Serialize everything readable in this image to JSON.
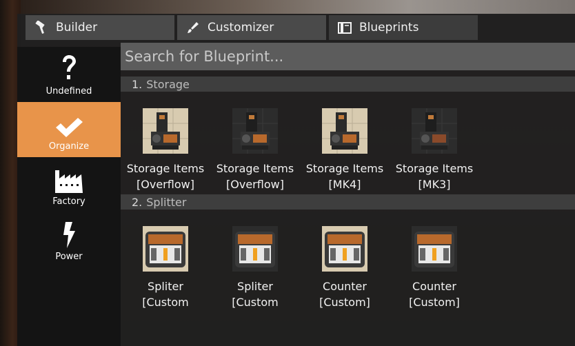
{
  "tabs": [
    {
      "label": "Builder",
      "icon": "hammer-icon",
      "active": false
    },
    {
      "label": "Customizer",
      "icon": "brush-icon",
      "active": false
    },
    {
      "label": "Blueprints",
      "icon": "blueprint-book-icon",
      "active": true
    }
  ],
  "sidebar": {
    "items": [
      {
        "label": "Undefined",
        "icon": "question-mark-icon",
        "active": false
      },
      {
        "label": "Organize",
        "icon": "checkmark-icon",
        "active": true
      },
      {
        "label": "Factory",
        "icon": "factory-icon",
        "active": false
      },
      {
        "label": "Power",
        "icon": "lightning-bolt-icon",
        "active": false
      }
    ]
  },
  "search": {
    "placeholder": "Search for Blueprint..."
  },
  "categories": [
    {
      "number": "1.",
      "name": "Storage",
      "items": [
        {
          "line1": "Storage Items",
          "line2": "[Overflow]",
          "icon": "storage-container-icon"
        },
        {
          "line1": "Storage Items",
          "line2": "[Overflow]",
          "icon": "storage-container-icon"
        },
        {
          "line1": "Storage Items",
          "line2": "[MK4]",
          "icon": "storage-container-icon"
        },
        {
          "line1": "Storage Items",
          "line2": "[MK3]",
          "icon": "storage-container-icon"
        }
      ]
    },
    {
      "number": "2.",
      "name": "Splitter",
      "items": [
        {
          "line1": "Spliter",
          "line2": "[Custom",
          "icon": "splitter-icon"
        },
        {
          "line1": "Spliter",
          "line2": "[Custom",
          "icon": "splitter-icon"
        },
        {
          "line1": "Counter",
          "line2": "[Custom]",
          "icon": "splitter-icon"
        },
        {
          "line1": "Counter",
          "line2": "[Custom]",
          "icon": "splitter-icon"
        }
      ]
    }
  ],
  "colors": {
    "accent": "#e8944a",
    "panel": "#202020",
    "search_bg": "#5c5c5c"
  }
}
